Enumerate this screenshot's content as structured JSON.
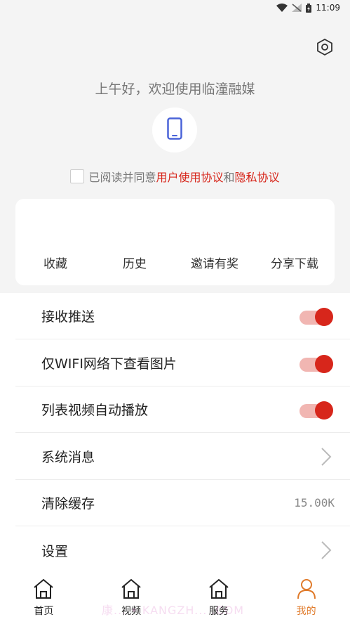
{
  "status_bar": {
    "time": "11:09"
  },
  "header": {
    "greeting": "上午好，欢迎使用临潼融媒"
  },
  "agreement": {
    "prefix": "已阅读并同意",
    "user_agreement": "用户使用协议",
    "conjunction": "和",
    "privacy_agreement": "隐私协议"
  },
  "quick_actions": [
    {
      "label": "收藏"
    },
    {
      "label": "历史"
    },
    {
      "label": "邀请有奖"
    },
    {
      "label": "分享下载"
    }
  ],
  "settings": {
    "receive_push": {
      "label": "接收推送",
      "enabled": true
    },
    "wifi_images": {
      "label": "仅WIFI网络下查看图片",
      "enabled": true
    },
    "autoplay": {
      "label": "列表视频自动播放",
      "enabled": true
    },
    "system_messages": {
      "label": "系统消息"
    },
    "clear_cache": {
      "label": "清除缓存",
      "value": "15.00K"
    },
    "settings": {
      "label": "设置"
    }
  },
  "tabs": [
    {
      "label": "首页",
      "icon": "home-icon"
    },
    {
      "label": "视频",
      "icon": "home-icon"
    },
    {
      "label": "服务",
      "icon": "home-icon"
    },
    {
      "label": "我的",
      "icon": "person-icon",
      "active": true
    }
  ],
  "watermark": "康... • KANGZH... .COM",
  "colors": {
    "accent": "#d7261b",
    "active_tab": "#e07a2a",
    "link": "#d7261b"
  }
}
